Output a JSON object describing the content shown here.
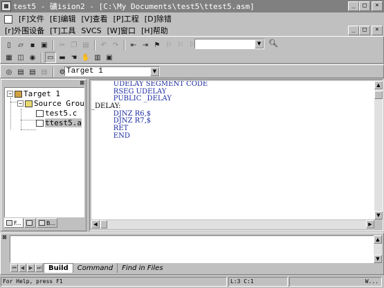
{
  "window": {
    "title": "test5  - 礦ision2 - [C:\\My Documents\\test5\\ttest5.asm]",
    "caption_buttons": [
      "_",
      "□",
      "×"
    ]
  },
  "menu": {
    "row1": [
      "[F]文件",
      "[E]编辑",
      "[V]查看",
      "[P]工程",
      "[D]除错"
    ],
    "row2": [
      "[r]外围设备",
      "[T]工具",
      "SVCS",
      "[W]窗口",
      "[H]帮助"
    ],
    "mdi_buttons": [
      "_",
      "□",
      "×"
    ]
  },
  "toolbar": {
    "find_text": "",
    "target_name": "Target 1"
  },
  "project": {
    "tree": {
      "target": "Target 1",
      "group": "Source Grou",
      "files": [
        "test5.c",
        "ttest5.a"
      ]
    },
    "tabs": [
      "F...",
      "",
      "B..."
    ]
  },
  "editor": {
    "lines": [
      {
        "indent": "          ",
        "text": "UDELAY SEGMENT CODE"
      },
      {
        "indent": "          ",
        "text": "RSEG UDELAY"
      },
      {
        "indent": "          ",
        "text": "PUBLIC _DELAY"
      },
      {
        "indent": "",
        "text": "_DELAY:"
      },
      {
        "indent": "          ",
        "text": "DJNZ R6,$"
      },
      {
        "indent": "          ",
        "text": "DJNZ R7,$"
      },
      {
        "indent": "          ",
        "text": "RET"
      },
      {
        "indent": "          ",
        "text": "END"
      }
    ]
  },
  "output": {
    "tabs": [
      "Build",
      "Command",
      "Find in Files"
    ],
    "active_tab": "Build"
  },
  "status": {
    "help": "For Help, press F1",
    "position": "L:3 C:1",
    "extra": "W..."
  },
  "colors": {
    "titlebar_inactive": "#808080",
    "keyword_blue": "#1a2aa0",
    "face": "#c0c0c0"
  }
}
